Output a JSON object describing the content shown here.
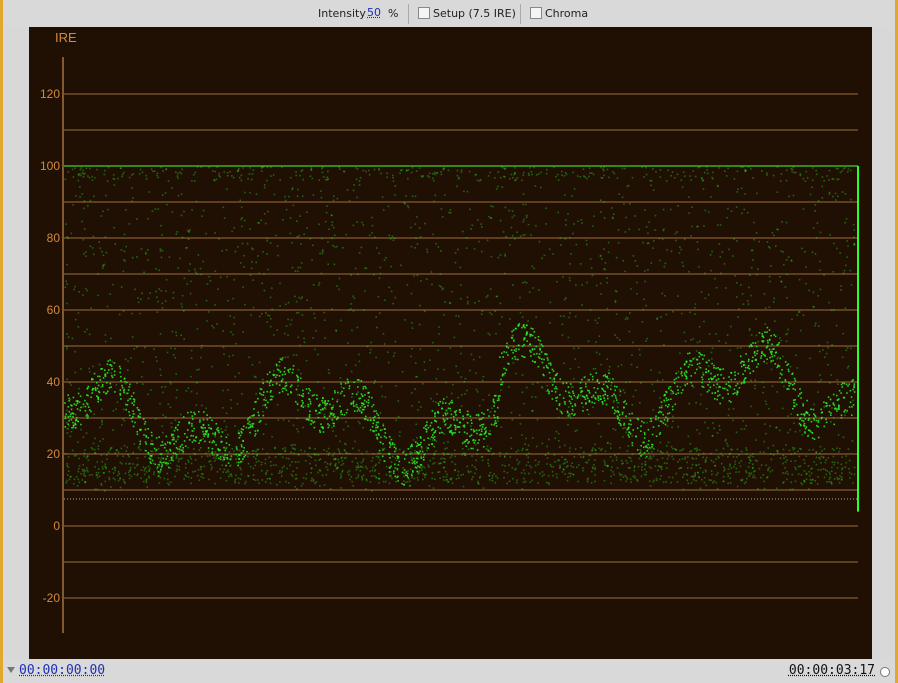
{
  "toolbar": {
    "intensity_label": "Intensity",
    "intensity_value": "50",
    "intensity_unit": "%",
    "setup_label": "Setup (7.5 IRE)",
    "setup_checked": false,
    "chroma_label": "Chroma",
    "chroma_checked": false
  },
  "scope": {
    "unit_label": "IRE",
    "ticks": [
      "120",
      "100",
      "80",
      "60",
      "40",
      "20",
      "0",
      "-20"
    ],
    "colors": {
      "background": "#201003",
      "gridline": "#e6a35c",
      "tick_text": "#d28a3c",
      "trace": "#2bff2b"
    }
  },
  "footer": {
    "timecode_start": "00:00:00:00",
    "timecode_end": "00:00:03:17"
  },
  "icons": {
    "collapse": "triangle-down-icon",
    "menu": "panel-menu-icon"
  }
}
